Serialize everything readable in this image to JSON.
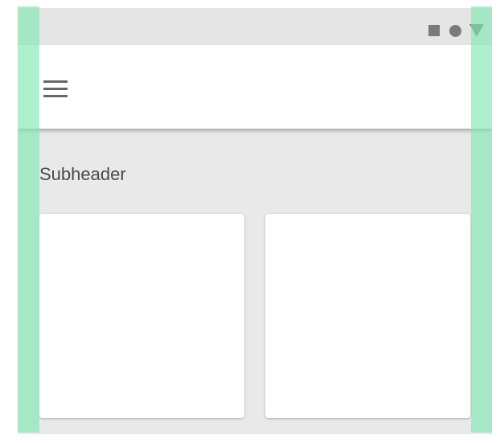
{
  "status_bar": {
    "icons": [
      "stop-square-icon",
      "circle-icon",
      "signal-triangle-icon"
    ]
  },
  "app_bar": {
    "menu_icon": "hamburger-menu-icon"
  },
  "content": {
    "subheader": "Subheader",
    "cards": [
      {
        "id": "card-1"
      },
      {
        "id": "card-2"
      }
    ]
  },
  "overlay": {
    "keyline_color": "#82e8b4"
  }
}
